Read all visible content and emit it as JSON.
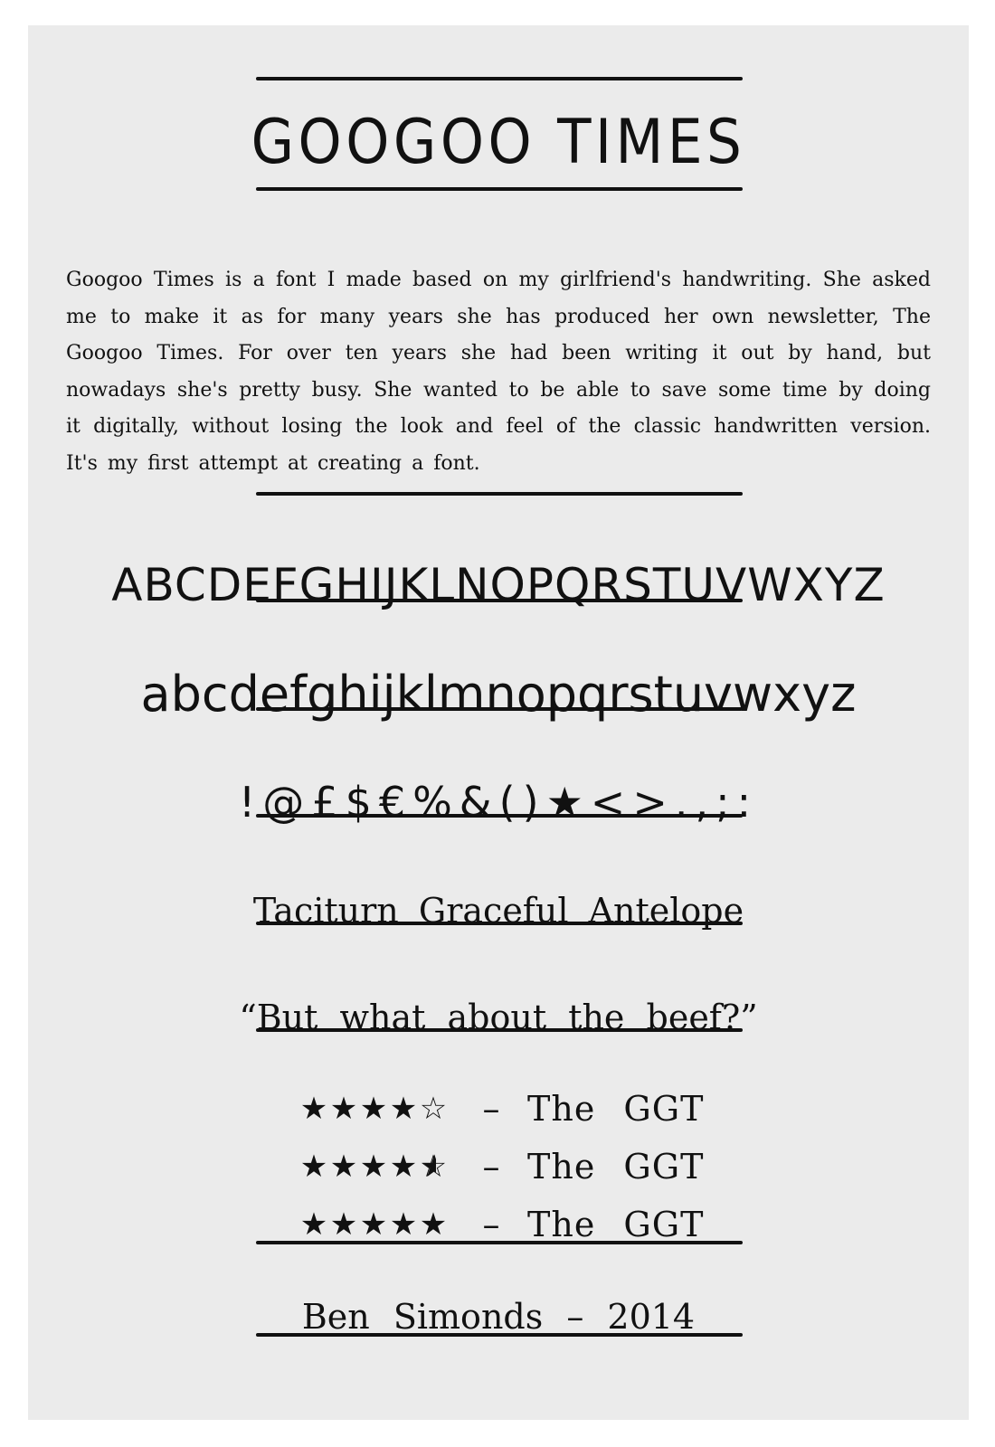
{
  "document": {
    "title": "GOOGOO TIMES",
    "intro": "Googoo Times is a font I made based on my girlfriend's handwriting. She asked me to make it as for many years she has produced her own newsletter, The Googoo Times. For over ten years she had been writing it out by hand, but nowadays she's pretty busy. She wanted to be able to save some time by doing it digitally, without losing the look and feel of the classic handwritten version. It's my first attempt at creating a font.",
    "uppercase": "ABCDEFGHIJKLNOPQRSTUVWXYZ",
    "lowercase": "abcdefghijklmnopqrstuvwxyz",
    "symbols": "!@£$€%&()★<>.,;:",
    "phrase": "Taciturn Graceful Antelope",
    "quote": "“But what about the beef?”",
    "ratings": [
      {
        "stars": 4,
        "dash": "–",
        "source": "The GGT"
      },
      {
        "stars": 4.5,
        "dash": "–",
        "source": "The GGT"
      },
      {
        "stars": 5,
        "dash": "–",
        "source": "The GGT"
      }
    ],
    "credit": "Ben Simonds – 2014"
  },
  "colors": {
    "page": "#ffffff",
    "sheet": "#ebebeb",
    "ink": "#111111"
  },
  "icons": {
    "filled_star": "star-filled-icon",
    "empty_star": "star-outline-icon",
    "half_star": "star-half-icon"
  }
}
